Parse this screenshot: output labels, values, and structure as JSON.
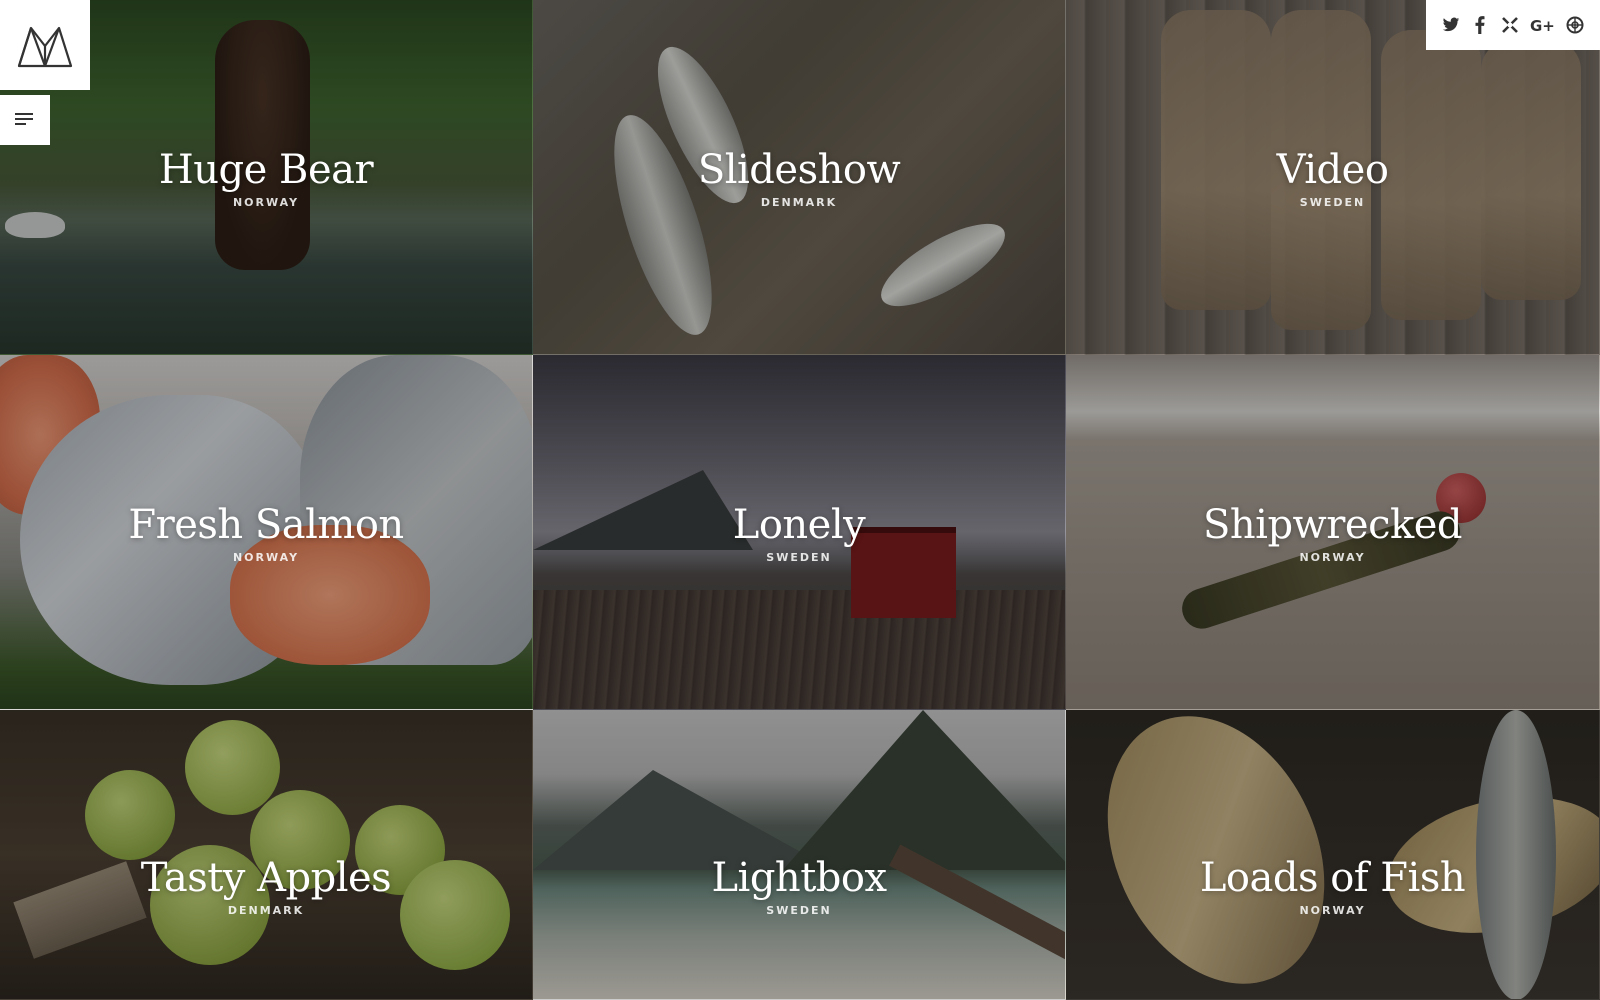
{
  "branding": {
    "logo_icon": "mountain-logo-icon"
  },
  "menu": {
    "icon": "menu-icon"
  },
  "social": [
    {
      "name": "twitter-icon",
      "glyph": "t"
    },
    {
      "name": "facebook-icon",
      "glyph": "f"
    },
    {
      "name": "xing-icon",
      "glyph": "✕"
    },
    {
      "name": "google-plus-icon",
      "glyph": "G+"
    },
    {
      "name": "dribbble-icon",
      "glyph": "◎"
    }
  ],
  "tiles": [
    {
      "title": "Huge Bear",
      "location": "NORWAY",
      "bg": "#3a4a34"
    },
    {
      "title": "Slideshow",
      "location": "DENMARK",
      "bg": "#5a5650"
    },
    {
      "title": "Video",
      "location": "SWEDEN",
      "bg": "#6a625a"
    },
    {
      "title": "Fresh Salmon",
      "location": "NORWAY",
      "bg": "#a0786a"
    },
    {
      "title": "Lonely",
      "location": "SWEDEN",
      "bg": "#4a4850"
    },
    {
      "title": "Shipwrecked",
      "location": "NORWAY",
      "bg": "#8a847c"
    },
    {
      "title": "Tasty Apples",
      "location": "DENMARK",
      "bg": "#4a4436"
    },
    {
      "title": "Lightbox",
      "location": "SWEDEN",
      "bg": "#6c7068"
    },
    {
      "title": "Loads of Fish",
      "location": "NORWAY",
      "bg": "#403a32"
    }
  ]
}
